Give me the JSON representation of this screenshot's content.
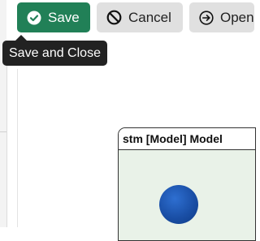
{
  "toolbar": {
    "save_label": "Save",
    "cancel_label": "Cancel",
    "open_label": "Open"
  },
  "tooltip": {
    "text": "Save and Close"
  },
  "diagram": {
    "title": "stm [Model] Model"
  },
  "colors": {
    "save_button": "#218057",
    "secondary_button": "#e0e0e0",
    "tooltip": "#222222",
    "diagram_bg": "#e9f2e8",
    "initial_state": "#1a4fa6"
  }
}
